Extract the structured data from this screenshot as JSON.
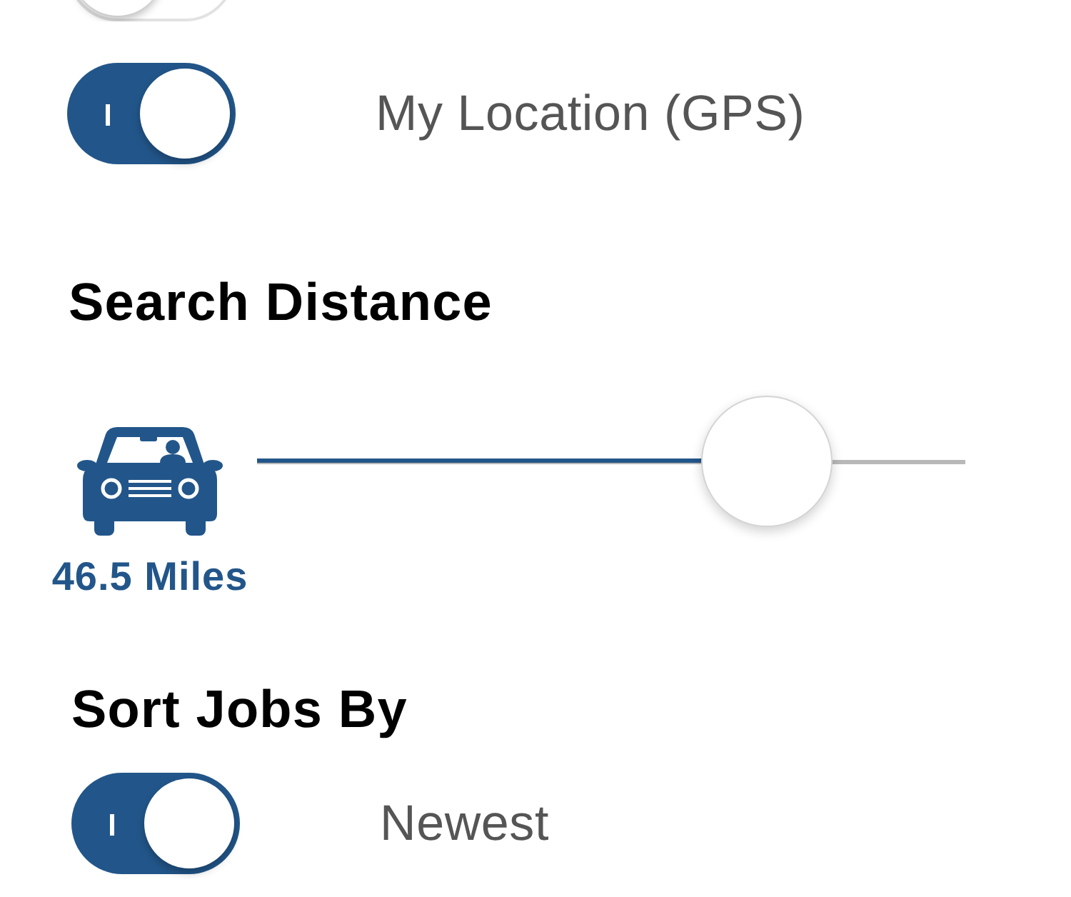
{
  "location_toggles": [
    {
      "on": false
    },
    {
      "label": "My Location (GPS)",
      "on": true
    }
  ],
  "search_distance": {
    "title": "Search Distance",
    "reading": "46.5 Miles",
    "level": 0.72
  },
  "sort_jobs": {
    "title": "Sort Jobs By",
    "options": [
      {
        "label": "Newest",
        "on": true
      }
    ]
  }
}
